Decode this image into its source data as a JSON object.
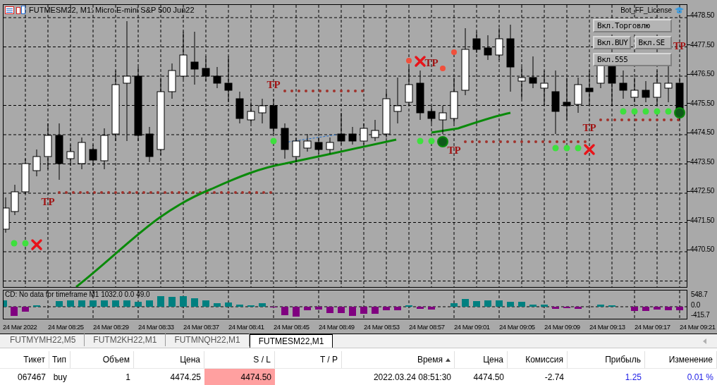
{
  "chart": {
    "title": "FUTMESM22, M1: Micro E-mini S&P 500 Jun22",
    "license": "Bot_FF_License",
    "buttons": [
      "Вкл.Торговлю",
      "Вкл.BUY",
      "Вкл.SE",
      "Вкл.555"
    ],
    "tp_labels": [
      "TP",
      "TP",
      "TP",
      "TP",
      "TP",
      "TP"
    ],
    "price_labels": [
      "4478.50",
      "4477.50",
      "4476.50",
      "4475.50",
      "4474.50",
      "4473.50",
      "4472.50",
      "4471.50",
      "4470.50"
    ],
    "indicator": {
      "label": "CD: No data for timeframe M1 1032.0 0.0 49.0",
      "scale": [
        "548.7",
        "0.0",
        "-415.7"
      ]
    },
    "time_labels": [
      "24 Mar 2022",
      "24 Mar 08:25",
      "24 Mar 08:29",
      "24 Mar 08:33",
      "24 Mar 08:37",
      "24 Mar 08:41",
      "24 Mar 08:45",
      "24 Mar 08:49",
      "24 Mar 08:53",
      "24 Mar 08:57",
      "24 Mar 09:01",
      "24 Mar 09:05",
      "24 Mar 09:09",
      "24 Mar 09:13",
      "24 Mar 09:17",
      "24 Mar 09:21"
    ]
  },
  "tabs": [
    {
      "label": "FUTMYMH22,M5",
      "selected": false
    },
    {
      "label": "FUTM2KH22,M1",
      "selected": false
    },
    {
      "label": "FUTMNQH22,M1",
      "selected": false
    },
    {
      "label": "FUTMESM22,M1",
      "selected": true
    }
  ],
  "table": {
    "columns": [
      {
        "label": "Тикет",
        "sorted": false
      },
      {
        "label": "Тип",
        "sorted": false
      },
      {
        "label": "Объем",
        "sorted": false
      },
      {
        "label": "Цена",
        "sorted": false
      },
      {
        "label": "S / L",
        "sorted": false
      },
      {
        "label": "T / P",
        "sorted": false
      },
      {
        "label": "Время",
        "sorted": true
      },
      {
        "label": "Цена",
        "sorted": false
      },
      {
        "label": "Комиссия",
        "sorted": false
      },
      {
        "label": "Прибыль",
        "sorted": false
      },
      {
        "label": "Изменение",
        "sorted": false
      }
    ],
    "rows": [
      {
        "cells": [
          {
            "text": "067467"
          },
          {
            "text": "buy"
          },
          {
            "text": "1"
          },
          {
            "text": "4474.25"
          },
          {
            "text": "4474.50",
            "highlighted": true
          },
          {},
          {
            "text": "2022.03.24 08:51:30"
          },
          {
            "text": "4474.50"
          },
          {
            "text": "-2.74"
          },
          {
            "text": "1.25"
          },
          {
            "text": "0.01 %"
          }
        ]
      }
    ]
  }
}
